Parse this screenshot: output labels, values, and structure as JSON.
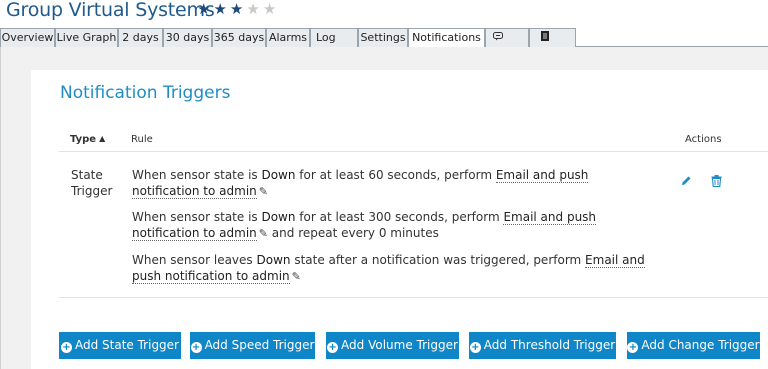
{
  "header": {
    "title": "Group Virtual Systems",
    "rating": 3,
    "rating_max": 5
  },
  "tabs": [
    {
      "label": "Overview"
    },
    {
      "label": "Live Graph"
    },
    {
      "label": "2 days"
    },
    {
      "label": "30 days"
    },
    {
      "label": "365 days"
    },
    {
      "label": "Alarms"
    },
    {
      "label": "Log"
    },
    {
      "label": "Settings"
    },
    {
      "label": "Notifications",
      "active": true
    },
    {
      "icon": "comment-icon"
    },
    {
      "icon": "history-icon"
    }
  ],
  "panel": {
    "title": "Notification Triggers",
    "columns": {
      "type": "Type",
      "rule": "Rule",
      "actions": "Actions"
    },
    "rows": [
      {
        "type_line1": "State",
        "type_line2": "Trigger",
        "rules": [
          {
            "p1": "When sensor state is ",
            "state": "Down",
            "p2": " for at least 60 seconds, perform ",
            "action": "Email and push notification to admin",
            "p3": ""
          },
          {
            "p1": "When sensor state is ",
            "state": "Down",
            "p2": " for at least 300 seconds, perform ",
            "action": "Email and push notification to admin",
            "p3": " and repeat every 0 minutes"
          },
          {
            "p1": "When sensor leaves ",
            "state": "Down",
            "p2": " state after a notification was triggered, perform ",
            "action": "Email and push notification to admin",
            "p3": ""
          }
        ]
      }
    ]
  },
  "buttons": [
    {
      "label": "Add State Trigger"
    },
    {
      "label": "Add Speed Trigger"
    },
    {
      "label": "Add Volume Trigger"
    },
    {
      "label": "Add Threshold Trigger"
    },
    {
      "label": "Add Change Trigger"
    }
  ],
  "colors": {
    "accent": "#1f8dc3",
    "button": "#0f86c8",
    "title": "#1f5a8c"
  }
}
